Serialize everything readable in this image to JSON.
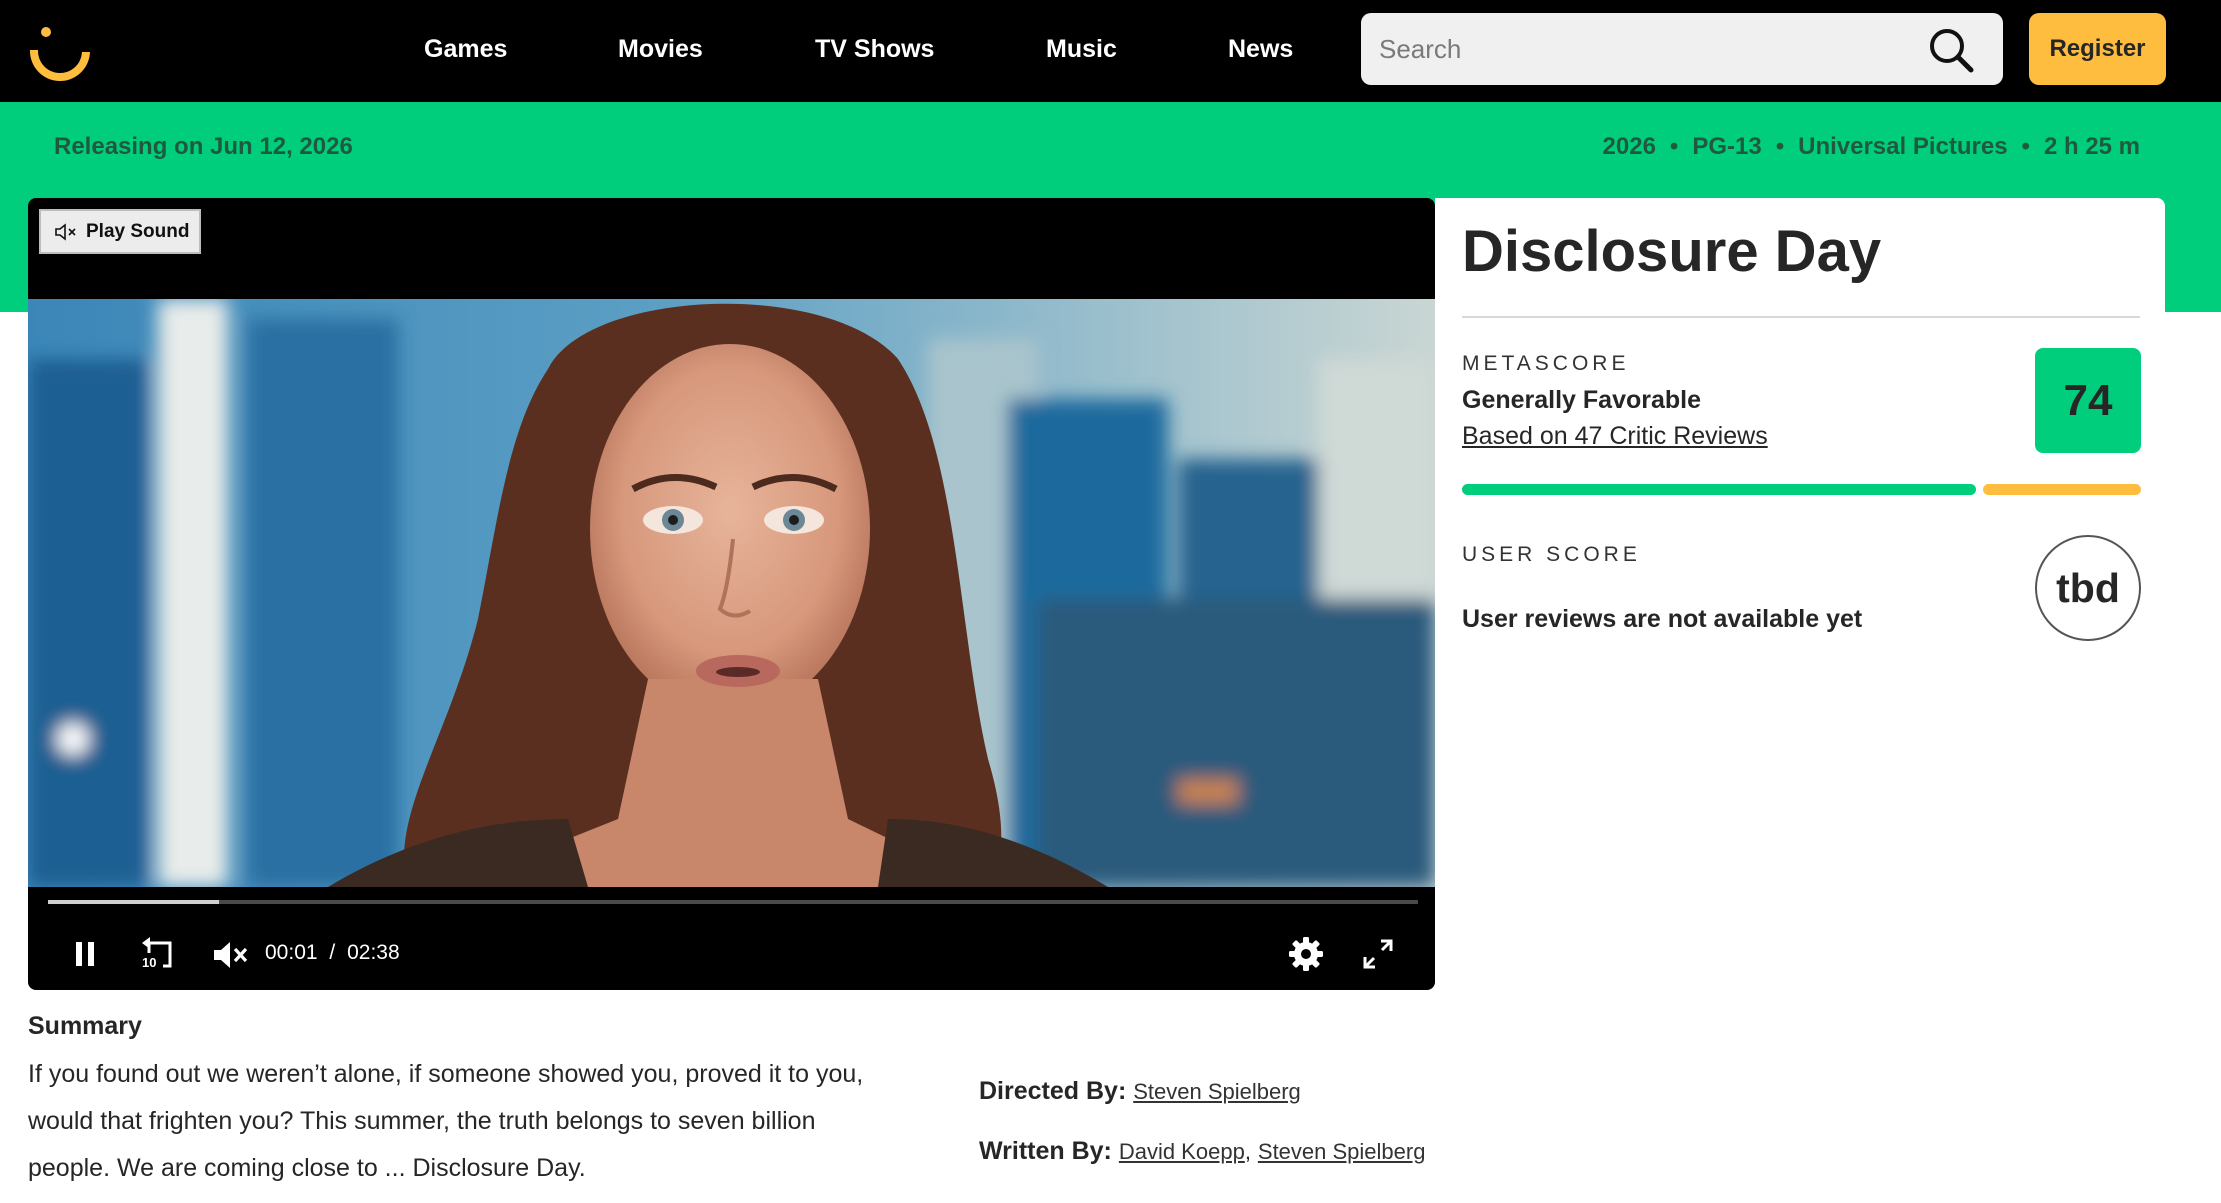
{
  "nav": {
    "links": [
      "Games",
      "Movies",
      "TV Shows",
      "Music",
      "News"
    ],
    "search_placeholder": "Search",
    "register_label": "Register"
  },
  "band": {
    "release": "Releasing on Jun 12, 2026",
    "year": "2026",
    "rating": "PG-13",
    "studio": "Universal Pictures",
    "runtime": "2 h 25 m",
    "separator": "•"
  },
  "video": {
    "play_sound_label": "Play Sound",
    "current_time": "00:01",
    "time_separator": "/",
    "duration": "02:38",
    "progress": 0.125,
    "skip_back_seconds": "10"
  },
  "movie": {
    "title": "Disclosure Day",
    "metascore_label": "METASCORE",
    "metascore_verdict": "Generally Favorable",
    "critic_reviews_link": "Based on 47 Critic Reviews",
    "metascore": "74",
    "positive_share": 0.765,
    "user_score_label": "USER SCORE",
    "user_score": "tbd",
    "user_score_note": "User reviews are not available yet"
  },
  "summary": {
    "heading": "Summary",
    "lines": [
      "If you found out we weren’t alone, if someone showed you, proved it to you,",
      "would that frighten you? This summer, the truth belongs to seven billion",
      "people. We are coming close to ... Disclosure Day."
    ]
  },
  "credits": {
    "directed_label": "Directed By:",
    "directors": [
      "Steven Spielberg"
    ],
    "written_label": "Written By:",
    "writers": [
      "David Koepp",
      "Steven Spielberg"
    ],
    "writer_separator": ","
  },
  "colors": {
    "brand_green": "#00ce7c",
    "brand_yellow": "#ffbd3f",
    "nav_bg": "#000000"
  }
}
